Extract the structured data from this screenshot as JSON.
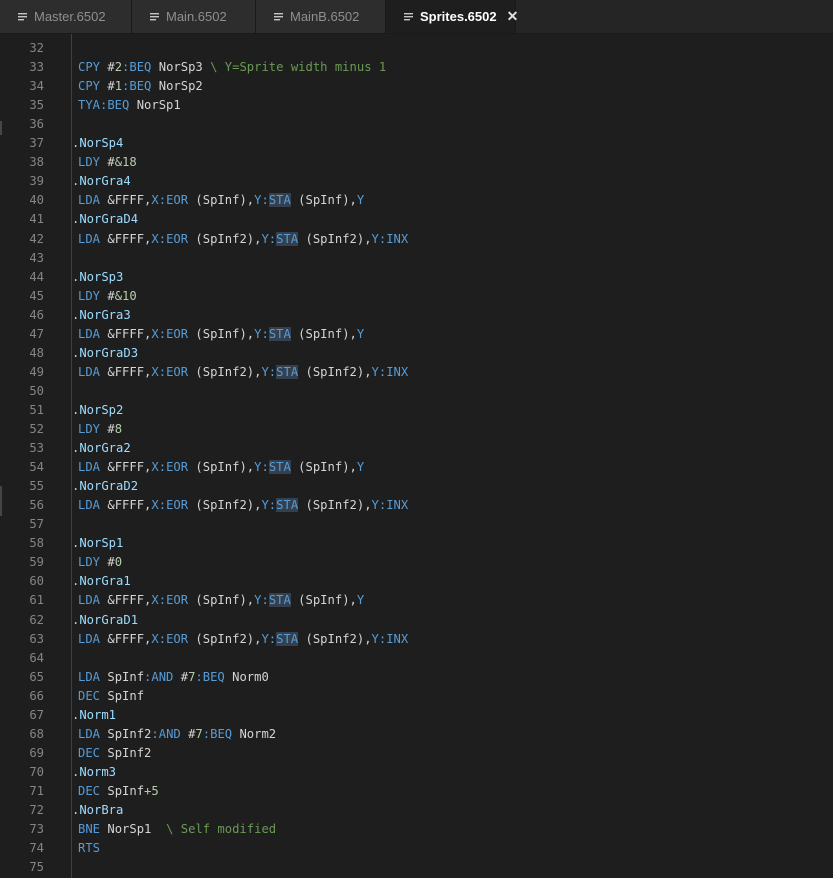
{
  "tabs": [
    {
      "label": "Master.6502",
      "icon": "file-text-icon",
      "active": false
    },
    {
      "label": "Main.6502",
      "icon": "file-text-icon",
      "active": false
    },
    {
      "label": "MainB.6502",
      "icon": "file-text-icon",
      "active": false
    },
    {
      "label": "Sprites.6502",
      "icon": "file-text-icon",
      "active": true,
      "close": "✕"
    }
  ],
  "first_line": 32,
  "lines": [
    [],
    [
      [
        "op",
        "CPY "
      ],
      [
        "txt",
        "#"
      ],
      [
        "num",
        "2"
      ],
      [
        "op",
        ":BEQ "
      ],
      [
        "txt",
        "NorSp3 "
      ],
      [
        "cmt",
        "\\ Y=Sprite width minus 1"
      ]
    ],
    [
      [
        "op",
        "CPY "
      ],
      [
        "txt",
        "#"
      ],
      [
        "num",
        "1"
      ],
      [
        "op",
        ":BEQ "
      ],
      [
        "txt",
        "NorSp2"
      ]
    ],
    [
      [
        "op",
        "TYA:BEQ "
      ],
      [
        "txt",
        "NorSp1"
      ]
    ],
    [],
    [
      [
        "lbl",
        ".NorSp4"
      ]
    ],
    [
      [
        "op",
        "LDY "
      ],
      [
        "txt",
        "#"
      ],
      [
        "num",
        "&18"
      ]
    ],
    [
      [
        "lbl",
        ".NorGra4"
      ]
    ],
    [
      [
        "op",
        "LDA "
      ],
      [
        "txt",
        "&FFFF,"
      ],
      [
        "op",
        "X:EOR "
      ],
      [
        "txt",
        "(SpInf),"
      ],
      [
        "op",
        "Y:"
      ],
      [
        "hl",
        "STA"
      ],
      [
        "txt",
        " (SpInf),"
      ],
      [
        "op",
        "Y"
      ]
    ],
    [
      [
        "lbl",
        ".NorGraD4"
      ]
    ],
    [
      [
        "op",
        "LDA "
      ],
      [
        "txt",
        "&FFFF,"
      ],
      [
        "op",
        "X:EOR "
      ],
      [
        "txt",
        "(SpInf2),"
      ],
      [
        "op",
        "Y:"
      ],
      [
        "hl",
        "STA"
      ],
      [
        "txt",
        " (SpInf2),"
      ],
      [
        "op",
        "Y:INX"
      ]
    ],
    [],
    [
      [
        "lbl",
        ".NorSp3"
      ]
    ],
    [
      [
        "op",
        "LDY "
      ],
      [
        "txt",
        "#"
      ],
      [
        "num",
        "&10"
      ]
    ],
    [
      [
        "lbl",
        ".NorGra3"
      ]
    ],
    [
      [
        "op",
        "LDA "
      ],
      [
        "txt",
        "&FFFF,"
      ],
      [
        "op",
        "X:EOR "
      ],
      [
        "txt",
        "(SpInf),"
      ],
      [
        "op",
        "Y:"
      ],
      [
        "hl",
        "STA"
      ],
      [
        "txt",
        " (SpInf),"
      ],
      [
        "op",
        "Y"
      ]
    ],
    [
      [
        "lbl",
        ".NorGraD3"
      ]
    ],
    [
      [
        "op",
        "LDA "
      ],
      [
        "txt",
        "&FFFF,"
      ],
      [
        "op",
        "X:EOR "
      ],
      [
        "txt",
        "(SpInf2),"
      ],
      [
        "op",
        "Y:"
      ],
      [
        "hl",
        "STA"
      ],
      [
        "txt",
        " (SpInf2),"
      ],
      [
        "op",
        "Y:INX"
      ]
    ],
    [],
    [
      [
        "lbl",
        ".NorSp2"
      ]
    ],
    [
      [
        "op",
        "LDY "
      ],
      [
        "txt",
        "#"
      ],
      [
        "num",
        "8"
      ]
    ],
    [
      [
        "lbl",
        ".NorGra2"
      ]
    ],
    [
      [
        "op",
        "LDA "
      ],
      [
        "txt",
        "&FFFF,"
      ],
      [
        "op",
        "X:EOR "
      ],
      [
        "txt",
        "(SpInf),"
      ],
      [
        "op",
        "Y:"
      ],
      [
        "hl",
        "STA"
      ],
      [
        "txt",
        " (SpInf),"
      ],
      [
        "op",
        "Y"
      ]
    ],
    [
      [
        "lbl",
        ".NorGraD2"
      ]
    ],
    [
      [
        "op",
        "LDA "
      ],
      [
        "txt",
        "&FFFF,"
      ],
      [
        "op",
        "X:EOR "
      ],
      [
        "txt",
        "(SpInf2),"
      ],
      [
        "op",
        "Y:"
      ],
      [
        "hl",
        "STA"
      ],
      [
        "txt",
        " (SpInf2),"
      ],
      [
        "op",
        "Y:INX"
      ]
    ],
    [],
    [
      [
        "lbl",
        ".NorSp1"
      ]
    ],
    [
      [
        "op",
        "LDY "
      ],
      [
        "txt",
        "#"
      ],
      [
        "num",
        "0"
      ]
    ],
    [
      [
        "lbl",
        ".NorGra1"
      ]
    ],
    [
      [
        "op",
        "LDA "
      ],
      [
        "txt",
        "&FFFF,"
      ],
      [
        "op",
        "X:EOR "
      ],
      [
        "txt",
        "(SpInf),"
      ],
      [
        "op",
        "Y:"
      ],
      [
        "hl",
        "STA"
      ],
      [
        "txt",
        " (SpInf),"
      ],
      [
        "op",
        "Y"
      ]
    ],
    [
      [
        "lbl",
        ".NorGraD1"
      ]
    ],
    [
      [
        "op",
        "LDA "
      ],
      [
        "txt",
        "&FFFF,"
      ],
      [
        "op",
        "X:EOR "
      ],
      [
        "txt",
        "(SpInf2),"
      ],
      [
        "op",
        "Y:"
      ],
      [
        "hl",
        "STA"
      ],
      [
        "txt",
        " (SpInf2),"
      ],
      [
        "op",
        "Y:INX"
      ]
    ],
    [],
    [
      [
        "op",
        "LDA "
      ],
      [
        "txt",
        "SpInf"
      ],
      [
        "op",
        ":AND "
      ],
      [
        "txt",
        "#"
      ],
      [
        "num",
        "7"
      ],
      [
        "op",
        ":BEQ "
      ],
      [
        "txt",
        "Norm0"
      ]
    ],
    [
      [
        "op",
        "DEC "
      ],
      [
        "txt",
        "SpInf"
      ]
    ],
    [
      [
        "lbl",
        ".Norm1"
      ]
    ],
    [
      [
        "op",
        "LDA "
      ],
      [
        "txt",
        "SpInf2"
      ],
      [
        "op",
        ":AND "
      ],
      [
        "txt",
        "#"
      ],
      [
        "num",
        "7"
      ],
      [
        "op",
        ":BEQ "
      ],
      [
        "txt",
        "Norm2"
      ]
    ],
    [
      [
        "op",
        "DEC "
      ],
      [
        "txt",
        "SpInf2"
      ]
    ],
    [
      [
        "lbl",
        ".Norm3"
      ]
    ],
    [
      [
        "op",
        "DEC "
      ],
      [
        "txt",
        "SpInf"
      ],
      [
        "num",
        "+5"
      ]
    ],
    [
      [
        "lbl",
        ".NorBra"
      ]
    ],
    [
      [
        "op",
        "BNE "
      ],
      [
        "txt",
        "NorSp1  "
      ],
      [
        "cmt",
        "\\ Self modified"
      ]
    ],
    [
      [
        "op",
        "RTS"
      ]
    ],
    []
  ],
  "colors": {
    "background": "#1e1e1e",
    "keyword": "#569cd6",
    "label": "#9cdcfe",
    "number": "#b5cea8",
    "comment": "#6a9955",
    "text": "#d4d4d4",
    "line_number": "#858585"
  }
}
